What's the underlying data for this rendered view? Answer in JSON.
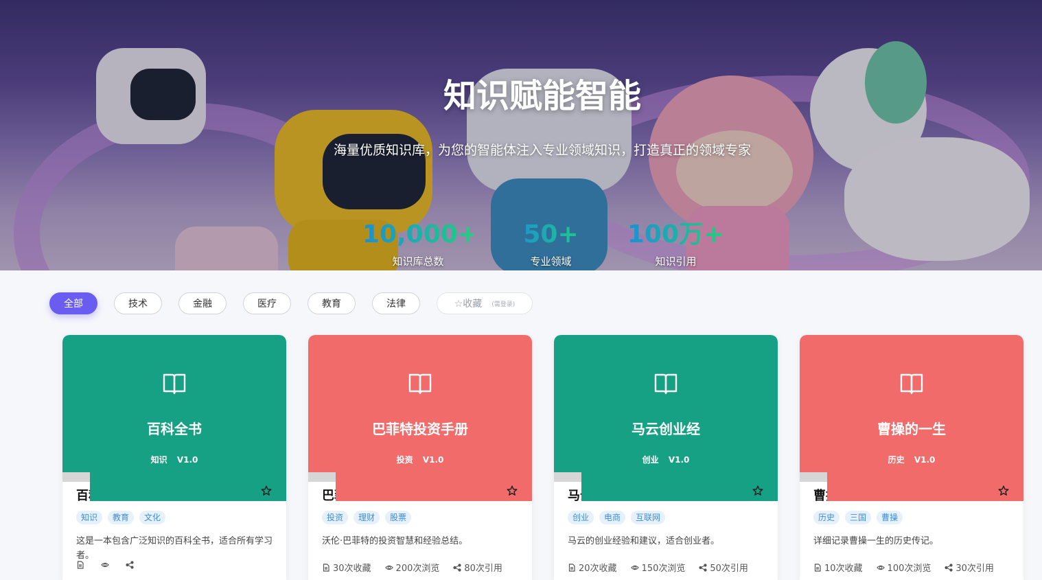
{
  "hero": {
    "title": "知识赋能智能",
    "subtitle": "海量优质知识库，为您的智能体注入专业领域知识，打造真正的领域专家",
    "stats": [
      {
        "value": "10,000+",
        "label": "知识库总数"
      },
      {
        "value": "50+",
        "label": "专业领域"
      },
      {
        "value": "100万+",
        "label": "知识引用"
      }
    ]
  },
  "filters": {
    "items": [
      "全部",
      "技术",
      "金融",
      "医疗",
      "教育",
      "法律"
    ],
    "favorite_label": "☆收藏",
    "favorite_hint": "(需登录)",
    "active_index": 0
  },
  "cards": [
    {
      "title": "百科全书",
      "category": "知识",
      "version": "V1.0",
      "name": "百科全书",
      "tags": [
        "知识",
        "教育",
        "文化"
      ],
      "description": "这是一本包含广泛知识的百科全书，适合所有学习者。",
      "favorites": "",
      "views": "",
      "references": "",
      "color": "#17a184"
    },
    {
      "title": "巴菲特投资手册",
      "category": "投资",
      "version": "V1.0",
      "name": "巴菲特投资手册",
      "tags": [
        "投资",
        "理财",
        "股票"
      ],
      "description": "沃伦·巴菲特的投资智慧和经验总结。",
      "favorites": "30次收藏",
      "views": "200次浏览",
      "references": "80次引用",
      "color": "#f26b6b"
    },
    {
      "title": "马云创业经",
      "category": "创业",
      "version": "V1.0",
      "name": "马云创业经",
      "tags": [
        "创业",
        "电商",
        "互联网"
      ],
      "description": "马云的创业经验和建议，适合创业者。",
      "favorites": "20次收藏",
      "views": "150次浏览",
      "references": "50次引用",
      "color": "#17a184"
    },
    {
      "title": "曹操的一生",
      "category": "历史",
      "version": "V1.0",
      "name": "曹操的一生",
      "tags": [
        "历史",
        "三国",
        "曹操"
      ],
      "description": "详细记录曹操一生的历史传记。",
      "favorites": "10次收藏",
      "views": "100次浏览",
      "references": "30次引用",
      "color": "#f26b6b"
    }
  ]
}
